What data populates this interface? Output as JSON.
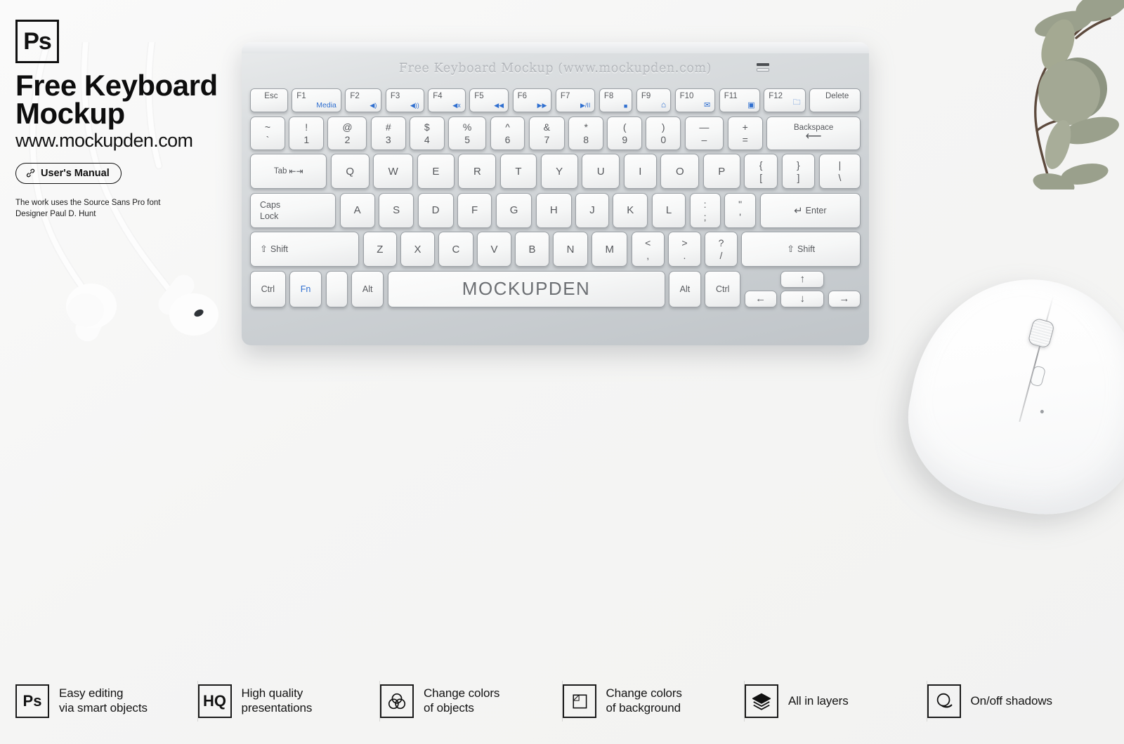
{
  "brand": {
    "logo_text": "Ps",
    "title_line1": "Free Keyboard",
    "title_line2": "Mockup",
    "url": "www.mockupden.com",
    "manual_button": "User's Manual",
    "manual_icon": "link-chain-icon",
    "credit_line1": "The work uses the Source Sans Pro font",
    "credit_line2": "Designer Paul D. Hunt"
  },
  "keyboard": {
    "engraving": "Free Keyboard Mockup (www.mockupden.com)",
    "spacebar_label": "MOCKUPDEN",
    "rows": {
      "function": [
        {
          "label": "Esc",
          "icon": ""
        },
        {
          "label": "F1",
          "icon": "Media",
          "icon_kind": "text"
        },
        {
          "label": "F2",
          "icon": "◀)",
          "icon_kind": "volume-down-icon"
        },
        {
          "label": "F3",
          "icon": "◀))",
          "icon_kind": "volume-up-icon"
        },
        {
          "label": "F4",
          "icon": "◀x",
          "icon_kind": "mute-icon"
        },
        {
          "label": "F5",
          "icon": "◀◀",
          "icon_kind": "previous-track-icon"
        },
        {
          "label": "F6",
          "icon": "▶▶",
          "icon_kind": "next-track-icon"
        },
        {
          "label": "F7",
          "icon": "▶/II",
          "icon_kind": "play-pause-icon"
        },
        {
          "label": "F8",
          "icon": "■",
          "icon_kind": "stop-icon"
        },
        {
          "label": "F9",
          "icon": "⌂",
          "icon_kind": "home-icon"
        },
        {
          "label": "F10",
          "icon": "✉",
          "icon_kind": "mail-icon"
        },
        {
          "label": "F11",
          "icon": "▣",
          "icon_kind": "window-icon"
        },
        {
          "label": "F12",
          "icon": "🗀",
          "icon_kind": "folder-icon"
        },
        {
          "label": "Delete",
          "icon": ""
        }
      ],
      "number": [
        {
          "top": "~",
          "bottom": "`"
        },
        {
          "top": "!",
          "bottom": "1"
        },
        {
          "top": "@",
          "bottom": "2"
        },
        {
          "top": "#",
          "bottom": "3"
        },
        {
          "top": "$",
          "bottom": "4"
        },
        {
          "top": "%",
          "bottom": "5"
        },
        {
          "top": "^",
          "bottom": "6"
        },
        {
          "top": "&",
          "bottom": "7"
        },
        {
          "top": "*",
          "bottom": "8"
        },
        {
          "top": "(",
          "bottom": "9"
        },
        {
          "top": ")",
          "bottom": "0"
        },
        {
          "top": "—",
          "bottom": "–"
        },
        {
          "top": "+",
          "bottom": "="
        }
      ],
      "backspace": "Backspace",
      "backspace_icon": "⟵",
      "tab": "Tab",
      "tab_icon": "⇤⇥",
      "qwerty": [
        "Q",
        "W",
        "E",
        "R",
        "T",
        "Y",
        "U",
        "I",
        "O",
        "P"
      ],
      "qwerty_tail": [
        {
          "top": "{",
          "bottom": "["
        },
        {
          "top": "}",
          "bottom": "]"
        },
        {
          "top": "|",
          "bottom": "\\"
        }
      ],
      "caps_line1": "Caps",
      "caps_line2": "Lock",
      "home": [
        "A",
        "S",
        "D",
        "F",
        "G",
        "H",
        "J",
        "K",
        "L"
      ],
      "home_tail": [
        {
          "top": ":",
          "bottom": ";"
        },
        {
          "top": "\"",
          "bottom": "'"
        }
      ],
      "enter": "Enter",
      "enter_icon": "↵",
      "shift_left": "Shift",
      "shift_right": "Shift",
      "shift_icon": "⇧",
      "zxcvb": [
        "Z",
        "X",
        "C",
        "V",
        "B",
        "N",
        "M"
      ],
      "zxcvb_tail": [
        {
          "top": "<",
          "bottom": ","
        },
        {
          "top": ">",
          "bottom": "."
        },
        {
          "top": "?",
          "bottom": "/"
        }
      ],
      "ctrl_left": "Ctrl",
      "fn": "Fn",
      "win": "",
      "alt_left": "Alt",
      "alt_right": "Alt",
      "ctrl_right": "Ctrl",
      "arrow_left": "←",
      "arrow_up": "↑",
      "arrow_down": "↓",
      "arrow_right": "→"
    }
  },
  "features": [
    {
      "icon_text": "Ps",
      "icon_name": "photoshop-icon",
      "line1": "Easy editing",
      "line2": "via smart objects"
    },
    {
      "icon_text": "HQ",
      "icon_name": "high-quality-icon",
      "line1": "High quality",
      "line2": "presentations"
    },
    {
      "icon_text": "",
      "icon_name": "color-circles-icon",
      "line1": "Change colors",
      "line2": "of objects"
    },
    {
      "icon_text": "",
      "icon_name": "background-square-icon",
      "line1": "Change colors",
      "line2": "of background"
    },
    {
      "icon_text": "",
      "icon_name": "layers-icon",
      "line1": "All in layers",
      "line2": ""
    },
    {
      "icon_text": "",
      "icon_name": "shadow-circle-icon",
      "line1": "On/off shadows",
      "line2": ""
    }
  ],
  "colors": {
    "background": "#f5f5f4",
    "accent_blue": "#2f6fd0",
    "key_face": "#f8f9f9",
    "keyboard_body": "#cfd3d6",
    "leaf_green": "#9aa08c",
    "stem_brown": "#5d4a3d",
    "text_dark": "#111111"
  }
}
